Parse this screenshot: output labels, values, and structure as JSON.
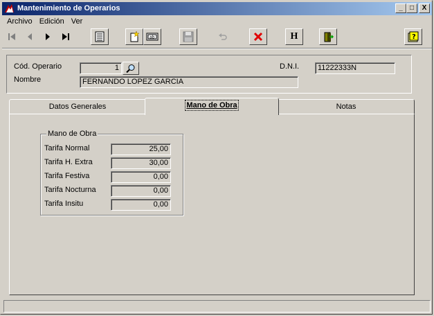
{
  "window": {
    "title": "Mantenimiento de Operarios",
    "controls": {
      "minimize": "_",
      "maximize": "□",
      "close": "X"
    }
  },
  "menu": [
    {
      "label": "Archivo"
    },
    {
      "label": "Edición"
    },
    {
      "label": "Ver"
    }
  ],
  "toolbar": {
    "buttons": [
      {
        "name": "first-record",
        "icon": "first-icon",
        "enabled": false
      },
      {
        "name": "prev-record",
        "icon": "prev-icon",
        "enabled": false
      },
      {
        "name": "next-record",
        "icon": "next-icon",
        "enabled": true
      },
      {
        "name": "last-record",
        "icon": "last-icon",
        "enabled": true
      },
      {
        "name": "list",
        "icon": "list-icon",
        "enabled": true
      },
      {
        "name": "new-record",
        "icon": "new-icon",
        "enabled": true
      },
      {
        "name": "edit-record",
        "icon": "edit-icon",
        "enabled": true
      },
      {
        "name": "save",
        "icon": "save-icon",
        "enabled": false
      },
      {
        "name": "undo",
        "icon": "undo-icon",
        "enabled": false
      },
      {
        "name": "delete",
        "icon": "delete-icon",
        "enabled": true
      },
      {
        "name": "history",
        "icon": "h-icon",
        "enabled": true,
        "text": "H"
      },
      {
        "name": "exit",
        "icon": "exit-door-icon",
        "enabled": true
      },
      {
        "name": "help",
        "icon": "help-icon",
        "enabled": true
      }
    ]
  },
  "header": {
    "codigo_label": "Cód. Operario",
    "codigo_value": "1",
    "dni_label": "D.N.I.",
    "dni_value": "11222333N",
    "nombre_label": "Nombre",
    "nombre_value": "FERNANDO LOPEZ GARCIA"
  },
  "tabs": [
    {
      "label": "Datos Generales",
      "active": false
    },
    {
      "label": "Mano de Obra",
      "active": true
    },
    {
      "label": "Notas",
      "active": false
    }
  ],
  "mano_de_obra": {
    "group_title": "Mano de Obra",
    "rows": [
      {
        "label": "Tarifa Normal",
        "value": "25,00"
      },
      {
        "label": "Tarifa H. Extra",
        "value": "30,00"
      },
      {
        "label": "Tarifa Festiva",
        "value": "0,00"
      },
      {
        "label": "Tarifa Nocturna",
        "value": "0,00"
      },
      {
        "label": "Tarifa Insitu",
        "value": "0,00"
      }
    ]
  },
  "colors": {
    "title_start": "#0a246a",
    "title_end": "#a6caf0",
    "face": "#d4d0c8",
    "delete_red": "#e00000"
  }
}
